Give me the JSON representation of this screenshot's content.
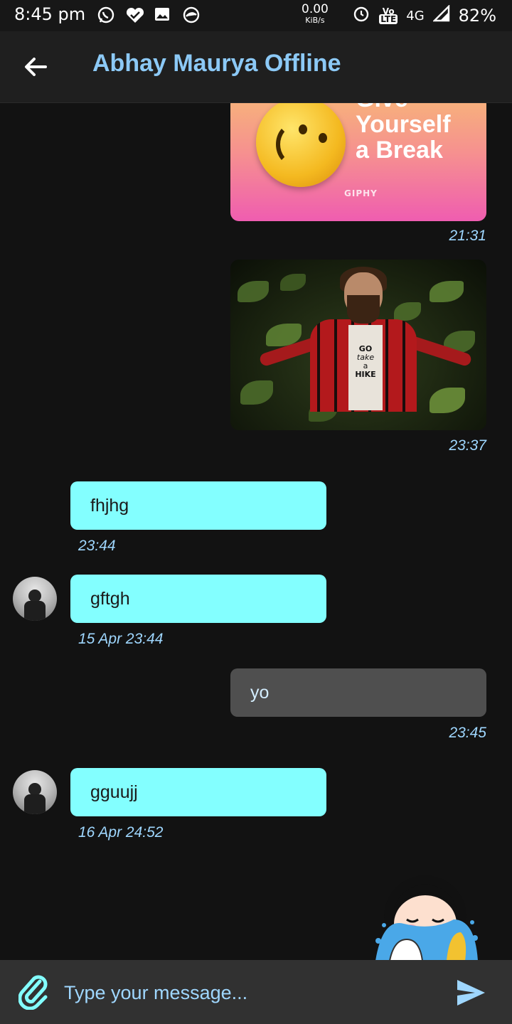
{
  "status_bar": {
    "time": "8:45 pm",
    "net_speed": "0.00",
    "net_unit": "KiB/s",
    "volte": "Vo",
    "lte": "LTE",
    "network": "4G",
    "battery": "82%",
    "icons": [
      "whatsapp-icon",
      "heart-check-icon",
      "gallery-icon",
      "alert-icon",
      "alarm-icon",
      "signal-icon"
    ]
  },
  "header": {
    "title": "Abhay Maurya Offline",
    "back_icon": "arrow-left-icon"
  },
  "messages": [
    {
      "type": "gif",
      "direction": "out",
      "text_lines": [
        "Give",
        "Yourself",
        "a Break"
      ],
      "badge": "GIPHY",
      "time": "21:31"
    },
    {
      "type": "image",
      "direction": "out",
      "shirt_text": [
        "GO",
        "take",
        "a",
        "HIKE"
      ],
      "time": "23:37"
    },
    {
      "type": "text",
      "direction": "in",
      "text": "fhjhg",
      "time": "23:44",
      "avatar": false
    },
    {
      "type": "text",
      "direction": "in",
      "text": "gftgh",
      "time": "15 Apr 23:44",
      "avatar": true
    },
    {
      "type": "text",
      "direction": "out",
      "text": "yo",
      "time": "23:45"
    },
    {
      "type": "text",
      "direction": "in",
      "text": "gguujj",
      "time": "16 Apr 24:52",
      "avatar": true
    },
    {
      "type": "sticker",
      "direction": "out"
    }
  ],
  "composer": {
    "placeholder": "Type your message...",
    "attach_icon": "paperclip-icon",
    "send_icon": "send-icon"
  },
  "colors": {
    "title": "#8cc9f6",
    "incoming_bubble": "#83ffff",
    "outgoing_bubble": "#4f4f4f",
    "timestamp": "#9fd7ff",
    "background": "#121212"
  }
}
